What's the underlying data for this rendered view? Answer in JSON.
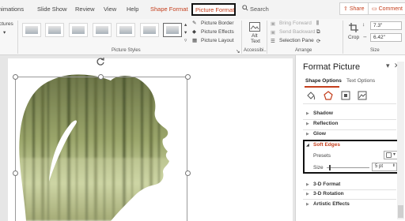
{
  "tabs": [
    {
      "label": "nimations"
    },
    {
      "label": "Slide Show"
    },
    {
      "label": "Review"
    },
    {
      "label": "View"
    },
    {
      "label": "Help"
    },
    {
      "label": "Shape Format"
    },
    {
      "label": "Picture Format"
    }
  ],
  "search": {
    "label": "Search"
  },
  "share": {
    "label": "Share"
  },
  "comments": {
    "label": "Comment"
  },
  "ribbon": {
    "cut_left": "ctures",
    "picture_styles_label": "Picture Styles",
    "picture_border": "Picture Border",
    "picture_effects": "Picture Effects",
    "picture_layout": "Picture Layout",
    "alt_text_1": "Alt",
    "alt_text_2": "Text",
    "accessibility_label": "Accessibi...",
    "bring_forward": "Bring Forward",
    "send_backward": "Send Backward",
    "selection_pane": "Selection Pane",
    "arrange_label": "Arrange",
    "crop": "Crop",
    "height_value": "7.3\"",
    "width_value": "6.42\"",
    "size_label": "Size"
  },
  "pane": {
    "title": "Format Picture",
    "tab_shape": "Shape Options",
    "tab_text": "Text Options",
    "sections": {
      "shadow": "Shadow",
      "reflection": "Reflection",
      "glow": "Glow",
      "soft_edges": "Soft Edges",
      "format_3d": "3-D Format",
      "rotation_3d": "3-D Rotation",
      "artistic": "Artistic Effects"
    },
    "presets_label": "Presets",
    "size_label": "Size",
    "size_value": "5 pt",
    "size_fraction": 0.05
  },
  "colors": {
    "accent": "#c43e1c",
    "forest_dark": "#4e5a2c",
    "forest_light": "#c9d2a0"
  }
}
